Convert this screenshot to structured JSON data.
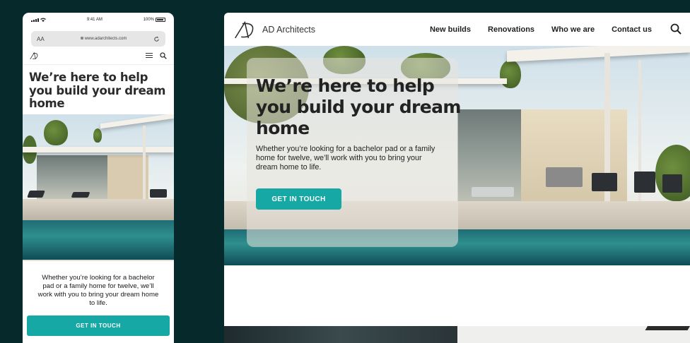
{
  "phone": {
    "status": {
      "time": "9:41 AM",
      "battery": "100%"
    },
    "url_bar": {
      "text_size": "AA",
      "url": "www.adarchitects.com"
    },
    "hero": {
      "title": "We’re here to help you build your dream home",
      "description": "Whether you’re looking for a bachelor pad or a family home for twelve, we’ll work with you to bring your dream home to life.",
      "cta": "GET IN TOUCH"
    }
  },
  "desktop": {
    "brand": "AD Architects",
    "nav": [
      "New builds",
      "Renovations",
      "Who we are",
      "Contact us"
    ],
    "hero": {
      "title": "We’re here to help you build your dream home",
      "description": "Whether you’re looking for a bachelor pad or a family home for twelve, we’ll work with you to bring your dream home to life.",
      "cta": "GET IN TOUCH"
    }
  },
  "colors": {
    "background": "#06292b",
    "accent": "#16a8a4",
    "text": "#222222"
  },
  "icons": [
    "logo-icon",
    "menu-icon",
    "search-icon",
    "reload-icon",
    "lock-icon",
    "wifi-icon",
    "battery-icon"
  ]
}
